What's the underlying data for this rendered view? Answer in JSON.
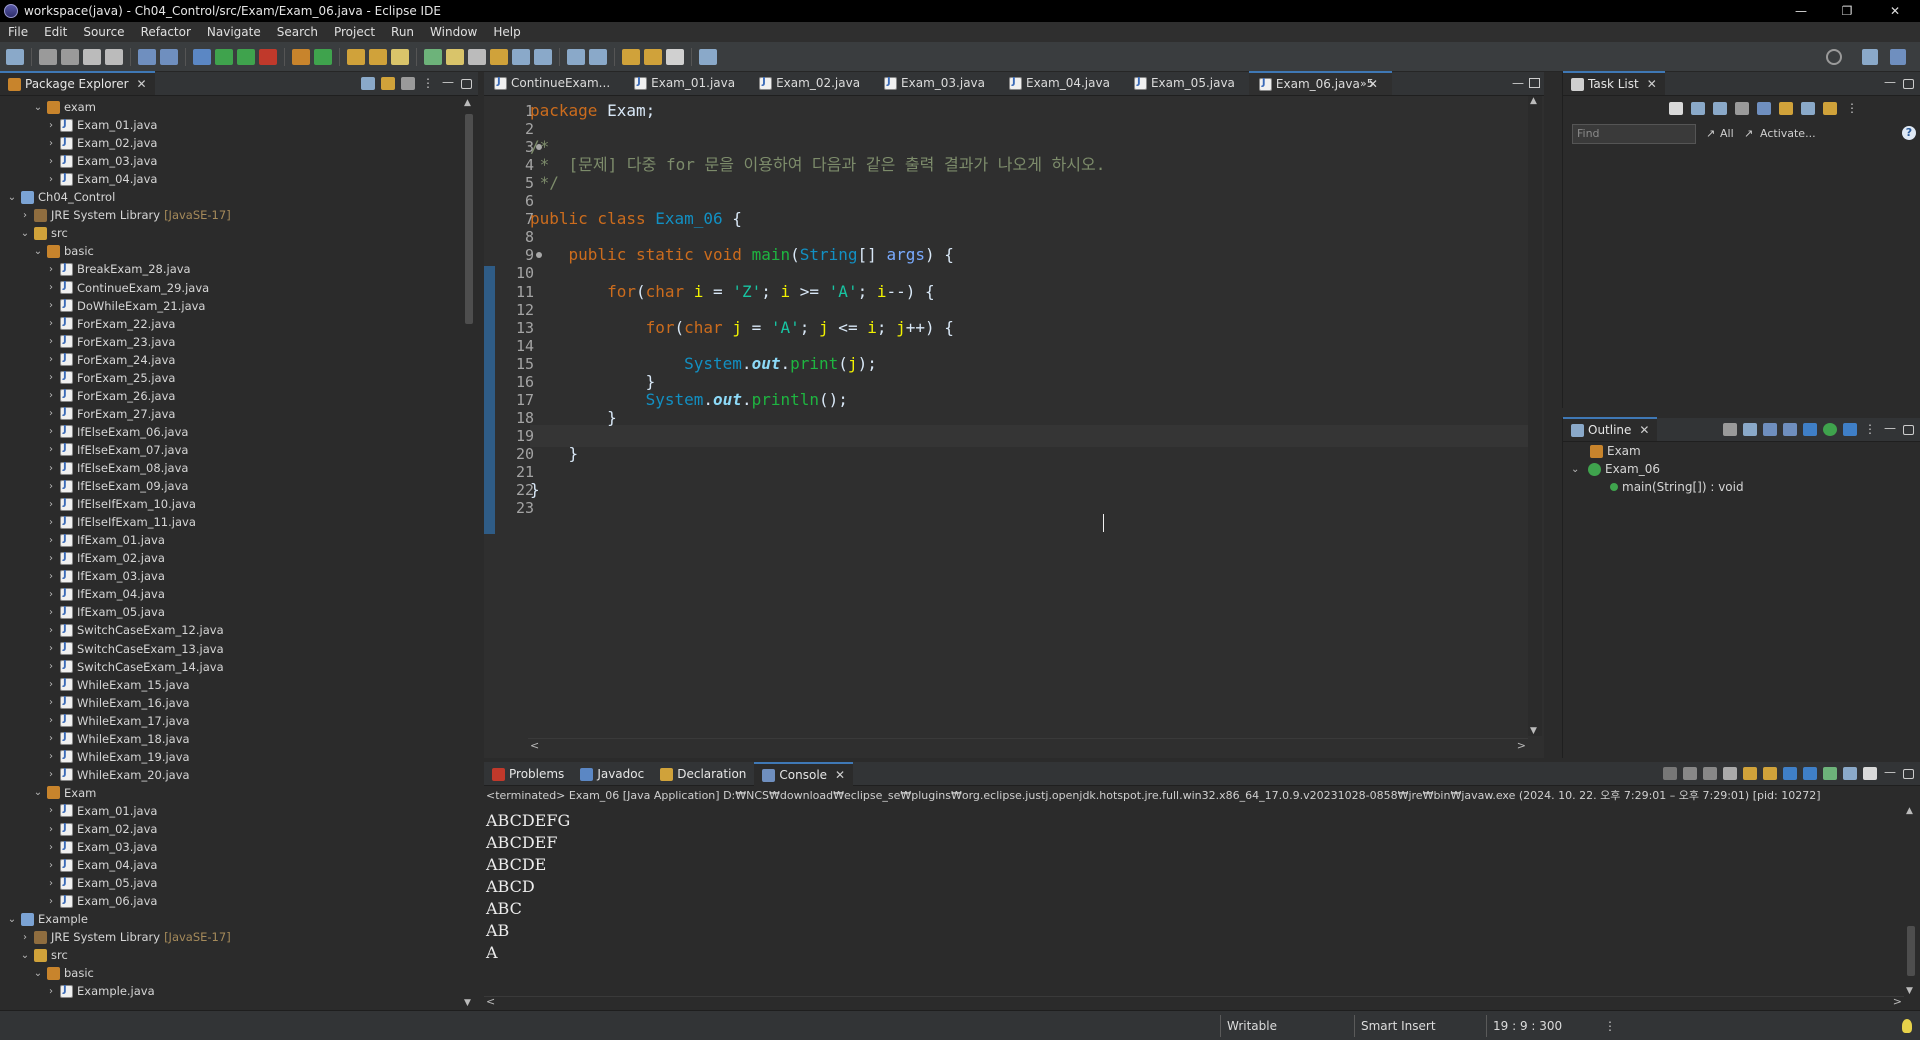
{
  "window": {
    "title": "workspace(java) - Ch04_Control/src/Exam/Exam_06.java - Eclipse IDE",
    "minimize": "—",
    "restore": "❐",
    "close": "✕"
  },
  "menu": [
    "File",
    "Edit",
    "Source",
    "Refactor",
    "Navigate",
    "Search",
    "Project",
    "Run",
    "Window",
    "Help"
  ],
  "package_explorer": {
    "tab_label": "Package Explorer",
    "rows": [
      {
        "label": "exam",
        "icon": "package-icon",
        "depth": 3,
        "twisty": "v"
      },
      {
        "label": "Exam_01.java",
        "icon": "java-file-icon",
        "depth": 4,
        "twisty": ">"
      },
      {
        "label": "Exam_02.java",
        "icon": "java-file-icon",
        "depth": 4,
        "twisty": ">"
      },
      {
        "label": "Exam_03.java",
        "icon": "java-file-icon",
        "depth": 4,
        "twisty": ">"
      },
      {
        "label": "Exam_04.java",
        "icon": "java-file-icon",
        "depth": 4,
        "twisty": ">"
      },
      {
        "label": "Ch04_Control",
        "icon": "project-icon",
        "depth": 1,
        "twisty": "v"
      },
      {
        "label": "JRE System Library",
        "decor": "[JavaSE-17]",
        "icon": "jre-library-icon",
        "depth": 2,
        "twisty": ">"
      },
      {
        "label": "src",
        "icon": "source-folder-icon",
        "depth": 2,
        "twisty": "v"
      },
      {
        "label": "basic",
        "icon": "package-icon",
        "depth": 3,
        "twisty": "v"
      },
      {
        "label": "BreakExam_28.java",
        "icon": "java-file-icon",
        "depth": 4,
        "twisty": ">"
      },
      {
        "label": "ContinueExam_29.java",
        "icon": "java-file-icon",
        "depth": 4,
        "twisty": ">"
      },
      {
        "label": "DoWhileExam_21.java",
        "icon": "java-file-icon",
        "depth": 4,
        "twisty": ">"
      },
      {
        "label": "ForExam_22.java",
        "icon": "java-file-icon",
        "depth": 4,
        "twisty": ">"
      },
      {
        "label": "ForExam_23.java",
        "icon": "java-file-icon",
        "depth": 4,
        "twisty": ">"
      },
      {
        "label": "ForExam_24.java",
        "icon": "java-file-icon",
        "depth": 4,
        "twisty": ">"
      },
      {
        "label": "ForExam_25.java",
        "icon": "java-file-icon",
        "depth": 4,
        "twisty": ">"
      },
      {
        "label": "ForExam_26.java",
        "icon": "java-file-icon",
        "depth": 4,
        "twisty": ">"
      },
      {
        "label": "ForExam_27.java",
        "icon": "java-file-icon",
        "depth": 4,
        "twisty": ">"
      },
      {
        "label": "IfElseExam_06.java",
        "icon": "java-file-icon",
        "depth": 4,
        "twisty": ">"
      },
      {
        "label": "IfElseExam_07.java",
        "icon": "java-file-icon",
        "depth": 4,
        "twisty": ">"
      },
      {
        "label": "IfElseExam_08.java",
        "icon": "java-file-icon",
        "depth": 4,
        "twisty": ">"
      },
      {
        "label": "IfElseExam_09.java",
        "icon": "java-file-icon",
        "depth": 4,
        "twisty": ">"
      },
      {
        "label": "IfElseIfExam_10.java",
        "icon": "java-file-icon",
        "depth": 4,
        "twisty": ">"
      },
      {
        "label": "IfElseIfExam_11.java",
        "icon": "java-file-icon",
        "depth": 4,
        "twisty": ">"
      },
      {
        "label": "IfExam_01.java",
        "icon": "java-file-icon",
        "depth": 4,
        "twisty": ">"
      },
      {
        "label": "IfExam_02.java",
        "icon": "java-file-icon",
        "depth": 4,
        "twisty": ">"
      },
      {
        "label": "IfExam_03.java",
        "icon": "java-file-icon",
        "depth": 4,
        "twisty": ">"
      },
      {
        "label": "IfExam_04.java",
        "icon": "java-file-icon",
        "depth": 4,
        "twisty": ">"
      },
      {
        "label": "IfExam_05.java",
        "icon": "java-file-icon",
        "depth": 4,
        "twisty": ">"
      },
      {
        "label": "SwitchCaseExam_12.java",
        "icon": "java-file-icon",
        "depth": 4,
        "twisty": ">"
      },
      {
        "label": "SwitchCaseExam_13.java",
        "icon": "java-file-icon",
        "depth": 4,
        "twisty": ">"
      },
      {
        "label": "SwitchCaseExam_14.java",
        "icon": "java-file-icon",
        "depth": 4,
        "twisty": ">"
      },
      {
        "label": "WhileExam_15.java",
        "icon": "java-file-icon",
        "depth": 4,
        "twisty": ">"
      },
      {
        "label": "WhileExam_16.java",
        "icon": "java-file-icon",
        "depth": 4,
        "twisty": ">"
      },
      {
        "label": "WhileExam_17.java",
        "icon": "java-file-icon",
        "depth": 4,
        "twisty": ">"
      },
      {
        "label": "WhileExam_18.java",
        "icon": "java-file-icon",
        "depth": 4,
        "twisty": ">"
      },
      {
        "label": "WhileExam_19.java",
        "icon": "java-file-icon",
        "depth": 4,
        "twisty": ">"
      },
      {
        "label": "WhileExam_20.java",
        "icon": "java-file-icon",
        "depth": 4,
        "twisty": ">"
      },
      {
        "label": "Exam",
        "icon": "package-icon",
        "depth": 3,
        "twisty": "v"
      },
      {
        "label": "Exam_01.java",
        "icon": "java-file-icon",
        "depth": 4,
        "twisty": ">"
      },
      {
        "label": "Exam_02.java",
        "icon": "java-file-icon",
        "depth": 4,
        "twisty": ">"
      },
      {
        "label": "Exam_03.java",
        "icon": "java-file-icon",
        "depth": 4,
        "twisty": ">"
      },
      {
        "label": "Exam_04.java",
        "icon": "java-file-icon",
        "depth": 4,
        "twisty": ">"
      },
      {
        "label": "Exam_05.java",
        "icon": "java-file-icon",
        "depth": 4,
        "twisty": ">"
      },
      {
        "label": "Exam_06.java",
        "icon": "java-file-icon",
        "depth": 4,
        "twisty": ">"
      },
      {
        "label": "Example",
        "icon": "project-icon",
        "depth": 1,
        "twisty": "v"
      },
      {
        "label": "JRE System Library",
        "decor": "[JavaSE-17]",
        "icon": "jre-library-icon",
        "depth": 2,
        "twisty": ">"
      },
      {
        "label": "src",
        "icon": "source-folder-icon",
        "depth": 2,
        "twisty": "v"
      },
      {
        "label": "basic",
        "icon": "package-icon",
        "depth": 3,
        "twisty": "v"
      },
      {
        "label": "Example.java",
        "icon": "java-file-icon",
        "depth": 4,
        "twisty": ">"
      }
    ]
  },
  "editor": {
    "tabs": [
      "ContinueExam...",
      "Exam_01.java",
      "Exam_02.java",
      "Exam_03.java",
      "Exam_04.java",
      "Exam_05.java",
      "Exam_06.java"
    ],
    "active_tab": 6,
    "overflow_label": "»5",
    "lines": [
      [
        [
          "kw",
          "package"
        ],
        [
          "plain",
          " Exam;"
        ]
      ],
      [],
      [
        [
          "cm",
          "/*"
        ]
      ],
      [
        [
          "cm",
          " *  [문제] 다중 for 문을 이용하여 다음과 같은 출력 결과가 나오게 하시오."
        ]
      ],
      [
        [
          "cm",
          " */"
        ]
      ],
      [],
      [
        [
          "kw",
          "public class "
        ],
        [
          "cls",
          "Exam_06"
        ],
        [
          "plain",
          " {"
        ]
      ],
      [],
      [
        [
          "plain",
          "    "
        ],
        [
          "kw",
          "public static void "
        ],
        [
          "fn",
          "main"
        ],
        [
          "plain",
          "("
        ],
        [
          "cls",
          "String"
        ],
        [
          "plain",
          "[] "
        ],
        [
          "prm",
          "args"
        ],
        [
          "plain",
          ") {"
        ]
      ],
      [],
      [
        [
          "plain",
          "        "
        ],
        [
          "kw",
          "for"
        ],
        [
          "plain",
          "("
        ],
        [
          "kw",
          "char "
        ],
        [
          "var",
          "i"
        ],
        [
          "plain",
          " = "
        ],
        [
          "str",
          "'Z'"
        ],
        [
          "plain",
          "; "
        ],
        [
          "var",
          "i"
        ],
        [
          "plain",
          " >= "
        ],
        [
          "str",
          "'A'"
        ],
        [
          "plain",
          "; "
        ],
        [
          "var",
          "i"
        ],
        [
          "plain",
          "--) {"
        ]
      ],
      [],
      [
        [
          "plain",
          "            "
        ],
        [
          "kw",
          "for"
        ],
        [
          "plain",
          "("
        ],
        [
          "kw",
          "char "
        ],
        [
          "var",
          "j"
        ],
        [
          "plain",
          " = "
        ],
        [
          "str",
          "'A'"
        ],
        [
          "plain",
          "; "
        ],
        [
          "var",
          "j"
        ],
        [
          "plain",
          " <= "
        ],
        [
          "var",
          "i"
        ],
        [
          "plain",
          "; "
        ],
        [
          "var",
          "j"
        ],
        [
          "plain",
          "++) {"
        ]
      ],
      [],
      [
        [
          "plain",
          "                "
        ],
        [
          "cls",
          "System"
        ],
        [
          "plain",
          "."
        ],
        [
          "fld",
          "out"
        ],
        [
          "plain",
          "."
        ],
        [
          "fn",
          "print"
        ],
        [
          "plain",
          "("
        ],
        [
          "var",
          "j"
        ],
        [
          "plain",
          ");"
        ]
      ],
      [
        [
          "plain",
          "            }"
        ]
      ],
      [
        [
          "plain",
          "            "
        ],
        [
          "cls",
          "System"
        ],
        [
          "plain",
          "."
        ],
        [
          "fld",
          "out"
        ],
        [
          "plain",
          "."
        ],
        [
          "fn",
          "println"
        ],
        [
          "plain",
          "();"
        ]
      ],
      [
        [
          "plain",
          "        }"
        ]
      ],
      [
        [
          "plain",
          "        "
        ]
      ],
      [
        [
          "plain",
          "    }"
        ]
      ],
      [],
      [
        [
          "plain",
          "}"
        ]
      ],
      []
    ],
    "fold_lines": [
      3,
      9
    ],
    "current_line": 19
  },
  "task_list": {
    "tab_label": "Task List",
    "find_placeholder": "Find",
    "all_label": "All",
    "activate_label": "Activate..."
  },
  "outline": {
    "tab_label": "Outline",
    "items": [
      {
        "label": "Exam",
        "icon": "package-icon",
        "depth": 0
      },
      {
        "label": "Exam_06",
        "icon": "class-icon",
        "depth": 0,
        "twisty": "v"
      },
      {
        "label": "main(String[]) : void",
        "icon": "method-icon",
        "depth": 1
      }
    ]
  },
  "bottom_panel": {
    "tabs": [
      "Problems",
      "Javadoc",
      "Declaration",
      "Console"
    ],
    "active_tab": 3,
    "terminated_line": "<terminated> Exam_06 [Java Application] D:₩NCS₩download₩eclipse_se₩plugins₩org.eclipse.justj.openjdk.hotspot.jre.full.win32.x86_64_17.0.9.v20231028-0858₩jre₩bin₩javaw.exe  (2024. 10. 22. 오후 7:29:01 – 오후 7:29:01) [pid: 10272]",
    "output": [
      "ABCDEFG",
      "ABCDEF",
      "ABCDE",
      "ABCD",
      "ABC",
      "AB",
      "A"
    ]
  },
  "status_bar": {
    "writable": "Writable",
    "insert_mode": "Smart Insert",
    "position": "19 : 9 : 300",
    "menu_dots": "⋮"
  },
  "colors": {
    "accent": "#3f78b5",
    "keyword": "#cc6c1d",
    "comment": "#7d8c6b",
    "class": "#1290c3",
    "method": "#1eb540",
    "string": "#17c6a3",
    "variable": "#f2f200"
  }
}
